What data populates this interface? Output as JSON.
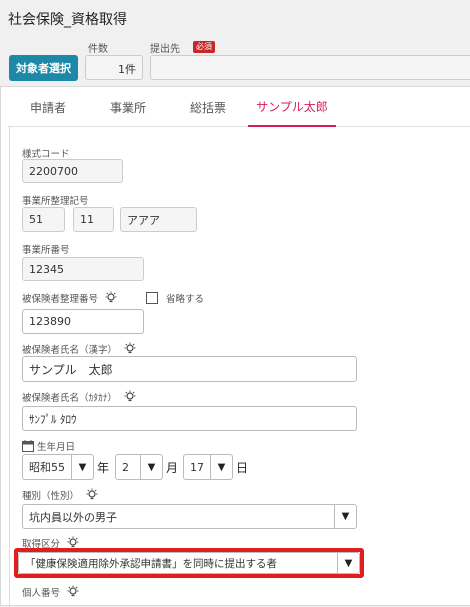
{
  "header": {
    "title": "社会保険_資格取得",
    "target_button": "対象者選択",
    "count_label": "件数",
    "count_value": "1件",
    "destination_label": "提出先",
    "required_badge": "必須",
    "destination_value": ""
  },
  "tabs": [
    {
      "label": "申請者",
      "active": false
    },
    {
      "label": "事業所",
      "active": false
    },
    {
      "label": "総括票",
      "active": false
    },
    {
      "label": "サンプル太郎",
      "active": true
    }
  ],
  "form": {
    "style_code": {
      "label": "様式コード",
      "value": "2200700"
    },
    "office_reg": {
      "label": "事業所整理記号",
      "values": [
        "51",
        "11",
        "アアア"
      ]
    },
    "office_no": {
      "label": "事業所番号",
      "value": "12345"
    },
    "insured_no": {
      "label": "被保険者整理番号",
      "omit_label": "省略する",
      "value": "123890"
    },
    "name_kanji": {
      "label": "被保険者氏名（漢字）",
      "value": "サンプル　太郎"
    },
    "name_kana": {
      "label": "被保険者氏名（ｶﾀｶﾅ）",
      "value": "ｻﾝﾌﾟﾙ ﾀﾛｳ"
    },
    "birthdate": {
      "label": "生年月日",
      "era": "昭和55",
      "year_unit": "年",
      "month": "2",
      "month_unit": "月",
      "day": "17",
      "day_unit": "日"
    },
    "category": {
      "label": "種別（性別）",
      "value": "坑内員以外の男子"
    },
    "acquisition": {
      "label": "取得区分",
      "value": "「健康保険適用除外承認申請書」を同時に提出する者"
    },
    "personal_no": {
      "label": "個人番号"
    }
  },
  "colors": {
    "accent": "#1e88a8",
    "tab_active": "#d81b60",
    "required": "#c62828",
    "highlight": "#e01e1e"
  }
}
